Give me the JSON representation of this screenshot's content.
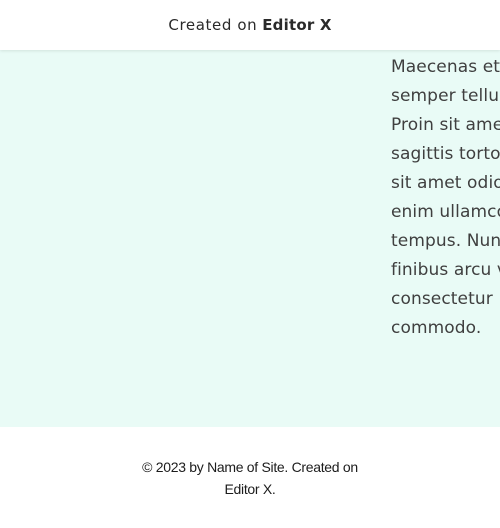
{
  "banner": {
    "created_on": "Created on",
    "brand": "Editor X"
  },
  "main": {
    "paragraph": "Maecenas et\nsemper tellus\nProin sit amet\nsagittis tortor.\nsit amet odio\nenim ullamcor\ntempus. Nunc\nfinibus arcu vi\nconsectetur\ncommodo."
  },
  "footer": {
    "line1": "© 2023 by Name of Site. Created on",
    "line2": "Editor X."
  }
}
